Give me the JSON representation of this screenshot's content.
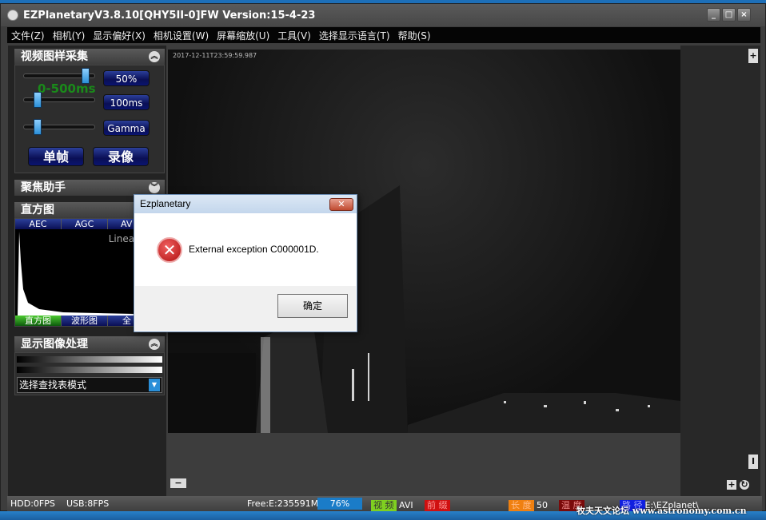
{
  "window": {
    "title": "EZPlanetaryV3.8.10[QHY5II-0]FW Version:15-4-23",
    "minimize": "_",
    "maximize": "□",
    "close": "×"
  },
  "menu": [
    "文件(Z)",
    "相机(Y)",
    "显示偏好(X)",
    "相机设置(W)",
    "屏幕缩放(U)",
    "工具(V)",
    "选择显示语言(T)",
    "帮助(S)"
  ],
  "capture_panel": {
    "title": "视频图样采集",
    "gain_label": "50%",
    "exposure_range": "0-500ms",
    "exposure_label": "100ms",
    "gamma_label": "Gamma",
    "single_frame": "单帧",
    "record": "录像",
    "gain_level": 0.9,
    "exposure_level": 0.15,
    "gamma_level": 0.15
  },
  "focus_panel": {
    "title": "聚焦助手"
  },
  "histogram_panel": {
    "title": "直方图",
    "tabs": [
      "AEC",
      "AGC",
      "AV"
    ],
    "scale": "Linear",
    "bottom_tabs": [
      "直方图",
      "波形图",
      "全"
    ]
  },
  "display_panel": {
    "title": "显示图像处理",
    "lut_select": "选择查找表模式"
  },
  "viewer": {
    "timestamp": "2017-12-11T23:59:59.987"
  },
  "zoom": {
    "in": "+",
    "out": "−"
  },
  "status": {
    "hdd": "HDD:0FPS",
    "usb": "USB:8FPS",
    "free": "Free:E:235591MB",
    "progress": "76%",
    "video_tag": "视 频",
    "video_fmt": "AVI",
    "prefix_tag": "前 缀",
    "length_tag": "长 度",
    "length_val": "50",
    "temp_tag": "温 度",
    "path_tag": "路 径",
    "path_val": "E:\\EZplanet\\",
    "watermark": "牧夫天文论坛 www.astronomy.com.cn",
    "colors": {
      "progress": "#1a7cc8",
      "video": "#7fd020",
      "prefix": "#d01010",
      "length": "#f08010",
      "temp": "#7a0a0a",
      "path": "#1020e0"
    }
  },
  "dialog": {
    "title": "Ezplanetary",
    "message": "External exception C000001D.",
    "ok": "确定",
    "close": "✕",
    "icon": "error-icon"
  }
}
